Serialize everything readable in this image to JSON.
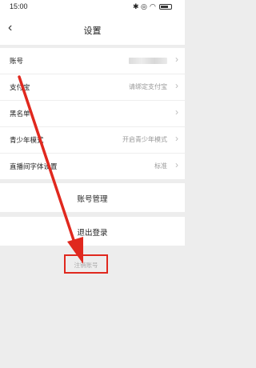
{
  "status_bar": {
    "time": "15:00",
    "icons": [
      "bluetooth-icon",
      "mute-icon",
      "wifi-icon",
      "battery-icon"
    ]
  },
  "nav": {
    "title": "设置",
    "back_icon": "chevron-left-icon"
  },
  "settings": [
    {
      "label": "账号",
      "value": ""
    },
    {
      "label": "支付宝",
      "value": "请绑定支付宝"
    },
    {
      "label": "黑名单",
      "value": ""
    },
    {
      "label": "青少年模式",
      "value": "开启青少年模式"
    },
    {
      "label": "直播间字体设置",
      "value": "标准"
    }
  ],
  "account_management": "账号管理",
  "logout": "退出登录",
  "cancel_account": "注销账号",
  "colors": {
    "annotation_red": "#e0281e",
    "background": "#ededed"
  }
}
